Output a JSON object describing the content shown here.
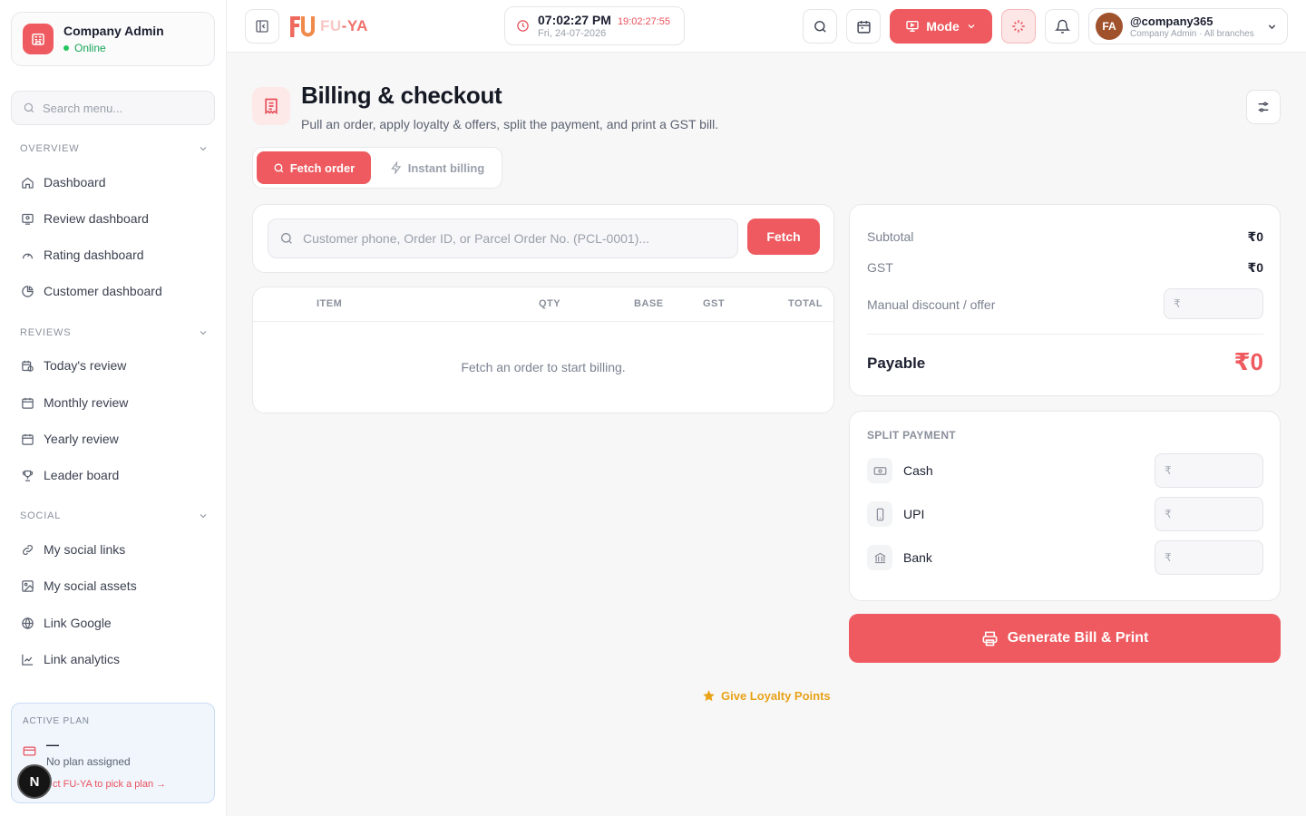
{
  "sidebar": {
    "company": {
      "name": "Company Admin",
      "status": "Online"
    },
    "search_placeholder": "Search menu...",
    "sections": [
      {
        "title": "OVERVIEW",
        "items": [
          {
            "label": "Dashboard",
            "icon": "home-icon"
          },
          {
            "label": "Review dashboard",
            "icon": "review-dashboard-icon"
          },
          {
            "label": "Rating dashboard",
            "icon": "gauge-icon"
          },
          {
            "label": "Customer dashboard",
            "icon": "pie-chart-icon"
          }
        ]
      },
      {
        "title": "REVIEWS",
        "items": [
          {
            "label": "Today's review",
            "icon": "calendar-clock-icon"
          },
          {
            "label": "Monthly review",
            "icon": "calendar-icon"
          },
          {
            "label": "Yearly review",
            "icon": "calendar-icon"
          },
          {
            "label": "Leader board",
            "icon": "trophy-icon"
          }
        ]
      },
      {
        "title": "SOCIAL",
        "items": [
          {
            "label": "My social links",
            "icon": "link-icon"
          },
          {
            "label": "My social assets",
            "icon": "image-icon"
          },
          {
            "label": "Link Google",
            "icon": "globe-icon"
          },
          {
            "label": "Link analytics",
            "icon": "line-chart-icon"
          }
        ]
      }
    ],
    "plan": {
      "label": "ACTIVE PLAN",
      "name": "—",
      "status": "No plan assigned",
      "link": "ct FU-YA to pick a plan →"
    },
    "bottom_badge": "N"
  },
  "topbar": {
    "logo_left": "FU",
    "logo_right": "-YA",
    "clock": {
      "time": "07:02:27 PM",
      "alt_time": "19:02:27:55",
      "date": "Fri, 24-07-2026"
    },
    "mode_label": "Mode",
    "user": {
      "initials": "FA",
      "handle": "@company365",
      "role": "Company Admin · All branches"
    }
  },
  "page": {
    "title": "Billing & checkout",
    "subtitle": "Pull an order, apply loyalty & offers, split the payment, and print a GST bill.",
    "tabs": [
      {
        "label": "Fetch order"
      },
      {
        "label": "Instant billing"
      }
    ],
    "fetch": {
      "placeholder": "Customer phone, Order ID, or Parcel Order No. (PCL-0001)...",
      "button": "Fetch"
    },
    "table": {
      "headers": [
        "ITEM",
        "QTY",
        "BASE",
        "GST",
        "TOTAL"
      ],
      "empty": "Fetch an order to start billing."
    },
    "summary": {
      "subtotal_label": "Subtotal",
      "subtotal": "₹0",
      "gst_label": "GST",
      "gst": "₹0",
      "discount_label": "Manual discount / offer",
      "payable_label": "Payable",
      "payable": "₹0"
    },
    "split": {
      "title": "SPLIT PAYMENT",
      "methods": [
        {
          "label": "Cash",
          "icon": "cash-icon"
        },
        {
          "label": "UPI",
          "icon": "phone-icon"
        },
        {
          "label": "Bank",
          "icon": "bank-icon"
        }
      ]
    },
    "currency_symbol": "₹",
    "generate_button": "Generate Bill & Print",
    "loyalty_link": "Give Loyalty Points"
  },
  "colors": {
    "accent": "#ee5a5f",
    "online": "#22c55e",
    "loyalty": "#e8a317"
  }
}
